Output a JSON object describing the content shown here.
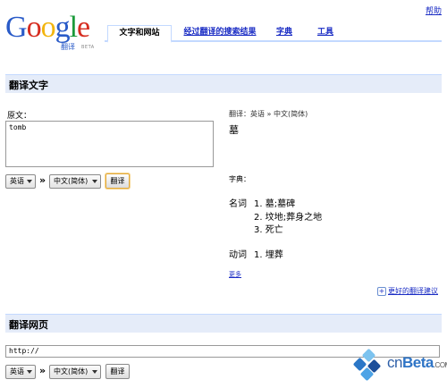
{
  "header": {
    "help_link": "帮助",
    "logo": {
      "word": "Google",
      "sub": "翻译",
      "beta": "BETA"
    },
    "tabs": [
      {
        "label": "文字和网站",
        "active": true
      },
      {
        "label": "经过翻译的搜索结果",
        "active": false
      },
      {
        "label": "字典",
        "active": false
      },
      {
        "label": "工具",
        "active": false
      }
    ]
  },
  "translate_text": {
    "section_title": "翻译文字",
    "source_label": "原文：",
    "source_text": "tomb",
    "from_language": "英语",
    "separator": "»",
    "to_language": "中文(简体)",
    "translate_button": "翻译"
  },
  "result": {
    "direction": "翻译：英语 » 中文(简体)",
    "translation": "墓",
    "dictionary_label": "字典：",
    "entries": [
      {
        "pos": "名词",
        "defs": [
          "1. 墓;墓碑",
          "2. 坟地;葬身之地",
          "3. 死亡"
        ]
      },
      {
        "pos": "动词",
        "defs": [
          "1. 埋葬"
        ]
      }
    ],
    "more_link": "更多",
    "better_translation_link": "更好的翻译建议"
  },
  "translate_web": {
    "section_title": "翻译网页",
    "url_value": "http://",
    "from_language": "英语",
    "separator": "»",
    "to_language": "中文(简体)",
    "translate_button": "翻译"
  },
  "watermark": {
    "brand_a": "cn",
    "brand_b": "Beta",
    "suffix": ".COM"
  },
  "colors": {
    "link": "#1a2cc4",
    "section_bg": "#e5ecf9",
    "tab_border": "#c3d9ff",
    "focus": "#e2a93b"
  }
}
